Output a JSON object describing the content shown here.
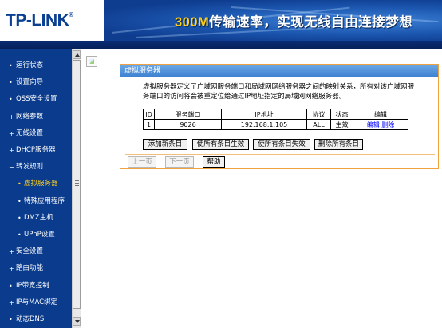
{
  "header": {
    "logo": "TP-LINK",
    "logo_reg": "®",
    "slogan_accent": "300M",
    "slogan_rest": "传输速率，实现无线自由连接梦想"
  },
  "sidebar": {
    "items": [
      {
        "label": "运行状态",
        "bullet": "•",
        "sub": false,
        "active": false
      },
      {
        "label": "设置向导",
        "bullet": "•",
        "sub": false,
        "active": false
      },
      {
        "label": "QSS安全设置",
        "bullet": "•",
        "sub": false,
        "active": false
      },
      {
        "label": "网络参数",
        "bullet": "+",
        "sub": false,
        "active": false
      },
      {
        "label": "无线设置",
        "bullet": "+",
        "sub": false,
        "active": false
      },
      {
        "label": "DHCP服务器",
        "bullet": "+",
        "sub": false,
        "active": false
      },
      {
        "label": "转发规则",
        "bullet": "−",
        "sub": false,
        "active": false
      },
      {
        "label": "虚拟服务器",
        "bullet": "•",
        "sub": true,
        "active": true
      },
      {
        "label": "特殊应用程序",
        "bullet": "•",
        "sub": true,
        "active": false
      },
      {
        "label": "DMZ主机",
        "bullet": "•",
        "sub": true,
        "active": false
      },
      {
        "label": "UPnP设置",
        "bullet": "•",
        "sub": true,
        "active": false
      },
      {
        "label": "安全设置",
        "bullet": "+",
        "sub": false,
        "active": false
      },
      {
        "label": "路由功能",
        "bullet": "+",
        "sub": false,
        "active": false
      },
      {
        "label": "IP带宽控制",
        "bullet": "•",
        "sub": false,
        "active": false
      },
      {
        "label": "IP与MAC绑定",
        "bullet": "+",
        "sub": false,
        "active": false
      },
      {
        "label": "动态DNS",
        "bullet": "•",
        "sub": false,
        "active": false
      }
    ]
  },
  "panel": {
    "title": "虚拟服务器",
    "description": "虚拟服务器定义了广域网服务端口和局域网网络服务器之间的映射关系，所有对该广域网服务端口的访问将会被重定位给通过IP地址指定的局域网网络服务器。",
    "table": {
      "headers": [
        "ID",
        "服务端口",
        "IP地址",
        "协议",
        "状态",
        "编辑"
      ],
      "rows": [
        {
          "id": "1",
          "port": "9026",
          "ip": "192.168.1.105",
          "protocol": "ALL",
          "status": "生效",
          "edit": "编辑",
          "delete": "删除"
        }
      ]
    },
    "buttons": {
      "add": "添加新条目",
      "enable_all": "使所有条目生效",
      "disable_all": "使所有条目失效",
      "delete_all": "删除所有条目"
    },
    "pager": {
      "prev": "上一页",
      "next": "下一页",
      "help": "帮助"
    }
  },
  "colors": {
    "brand_blue": "#0a3b8c",
    "accent_yellow": "#ffd11a",
    "panel_border": "#f0a23e",
    "link": "#0000ff"
  }
}
